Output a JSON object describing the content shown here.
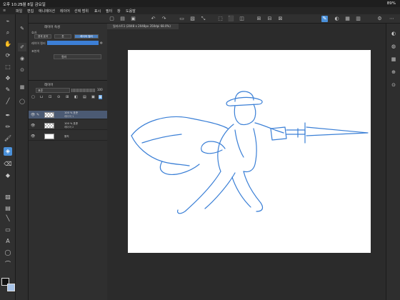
{
  "status": {
    "time": "오후 10:25",
    "date": "5월 8일 금요일",
    "right": "89%"
  },
  "menu": [
    "파일",
    "편집",
    "애니메이션",
    "레이어",
    "선택 범위",
    "표시",
    "필터",
    "창",
    "도움말"
  ],
  "canvas_tab": "일러스트1 (2048 x 2048px 350dpi 68.0%)",
  "props": {
    "title": "레이어 속성",
    "effect_label": "효과",
    "seg": [
      "경계 효과",
      "톤",
      "레이어 컬러"
    ],
    "layer_color_label": "레이어 컬러",
    "expression_label": "표현색",
    "expression_value": "컬러"
  },
  "layers": {
    "title": "레이어",
    "blend": "표준",
    "opacity": "100",
    "rows": [
      {
        "name1": "100 % 표준",
        "name2": "레이어 1"
      },
      {
        "name1": "100 % 표준",
        "name2": "레이어 2"
      },
      {
        "name": "용지"
      }
    ]
  },
  "colors": {
    "accent": "#4a90d9",
    "stroke": "#3a7fd6"
  },
  "tools": [
    "eyedropper-icon",
    "zoom-icon",
    "hand-icon",
    "rotate-icon",
    "select-icon",
    "move-icon",
    "lasso-icon",
    "dropper-icon",
    "pen-icon",
    "pencil-icon",
    "brush-icon",
    "airbrush-icon",
    "eraser-icon",
    "fill-icon",
    "gradient-icon",
    "figure-icon",
    "text-icon",
    "balloon-icon",
    "ruler-icon"
  ]
}
